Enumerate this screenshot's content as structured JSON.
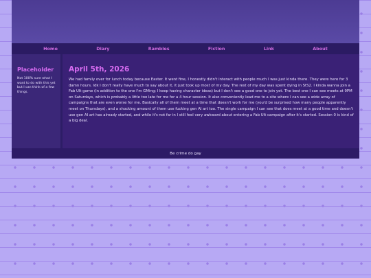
{
  "nav": {
    "items": [
      "Home",
      "Diary",
      "Rambles",
      "Fiction",
      "Link",
      "About"
    ]
  },
  "sidebar": {
    "title": "Placeholder",
    "text": "Not 100% sure what I want to do with this yet but I can think of a few things."
  },
  "post": {
    "title": "April 5th, 2026",
    "body": "We had family over for lunch today because Easter. It went fine, I honestly didn't interact with people much I was just kinda there. They were here for 3 damn hours. Idk I don't really have much to say about it, it just took up most of my day. The rest of my day was spent dying in StS2. I kinda wanna join a Fab Ult game (in addition to the one I'm GMing; I keep having character ideas) but I don't see a good one to join yet. The best one I can see meets at 9PM on Saturdays, which is probably a little too late for me for a 4 hour session. It also conveniently lead me to a site where I can see a wide array of campaigns that are even worse for me. Basically all of them meet at a time that doesn't work for me (you'd be surprised how many people apparently meet on Thursdays), and a shocking amount of them use fucking gen AI art too. The single campaign I can see that does meet at a good time and doesn't use gen AI art has already started, and while it's not far in I still feel very awkward about entering a Fab Ult campaign after it's started. Session 0 is kind of a big deal."
  },
  "footer": {
    "text": "Be crime do gay"
  },
  "colors": {
    "accent": "#d66bf0",
    "nav_bg": "#2b1b63",
    "panel_bg": "#3a2176",
    "page_bg": "#b7a9f4"
  }
}
